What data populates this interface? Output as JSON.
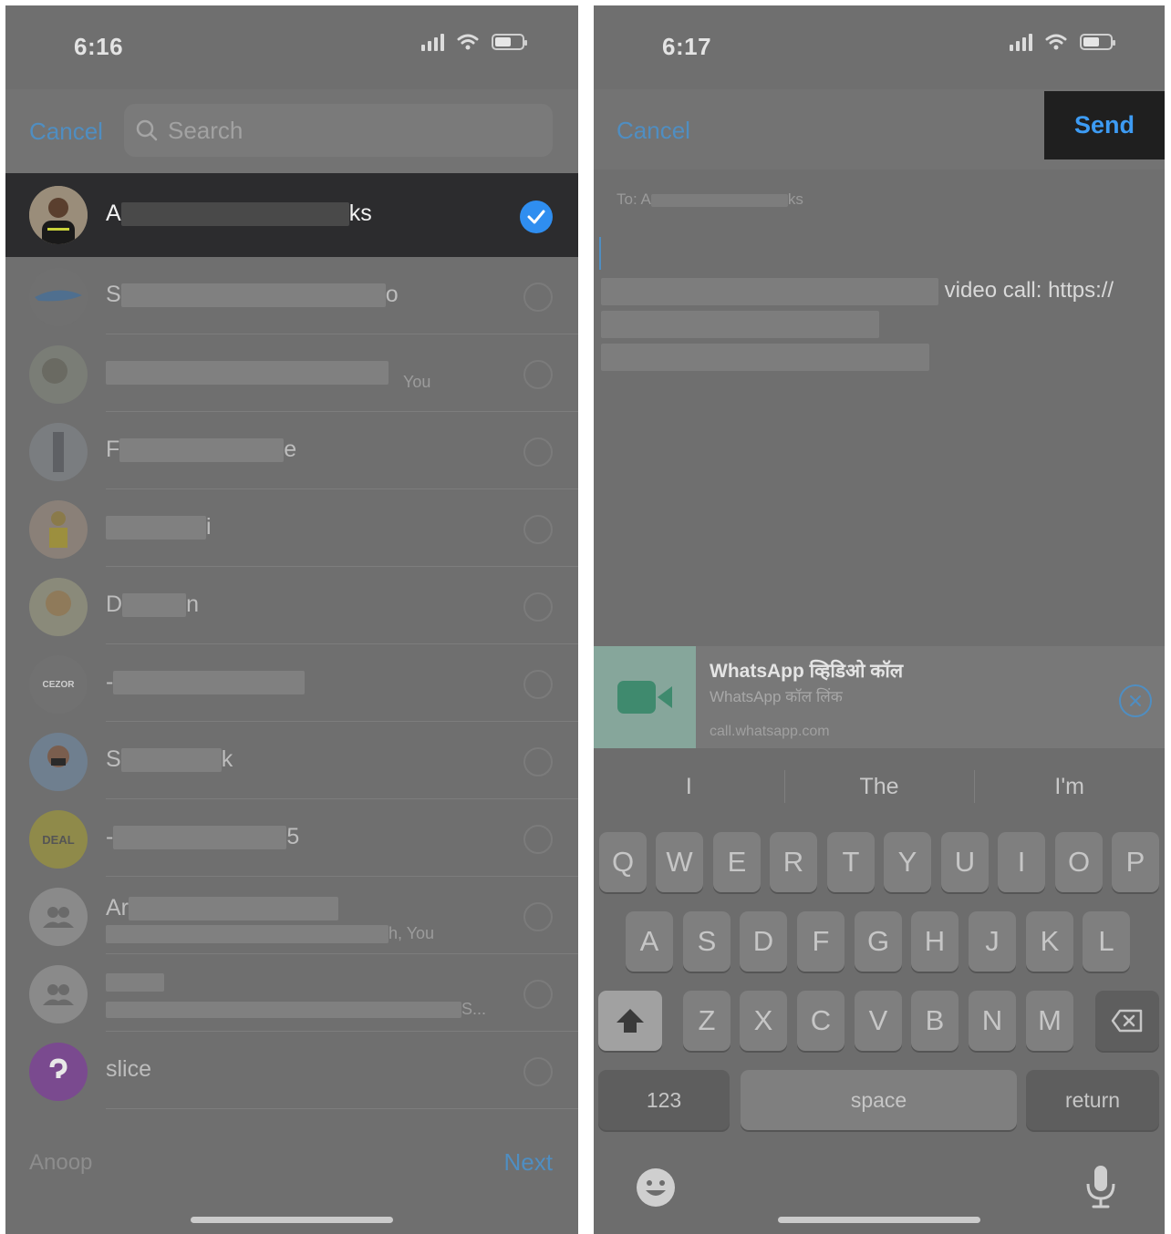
{
  "left": {
    "status_time": "6:16",
    "cancel_label": "Cancel",
    "search_placeholder": "Search",
    "contacts": [
      {
        "name_start": "A",
        "name_end": "ks",
        "sub": "",
        "selected": true
      },
      {
        "name_start": "S",
        "name_end": "o",
        "sub": "",
        "selected": false
      },
      {
        "name_start": "",
        "name_end": "",
        "sub": "You",
        "selected": false
      },
      {
        "name_start": "F",
        "name_end": "e",
        "sub": "",
        "selected": false
      },
      {
        "name_start": "",
        "name_end": "i",
        "sub": "",
        "selected": false
      },
      {
        "name_start": "D",
        "name_end": "n",
        "sub": "",
        "selected": false
      },
      {
        "name_start": "-",
        "name_end": "",
        "sub": "",
        "selected": false
      },
      {
        "name_start": "S",
        "name_end": "k",
        "sub": "",
        "selected": false
      },
      {
        "name_start": "-",
        "name_end": "5",
        "sub": "",
        "selected": false
      },
      {
        "name_start": "Ar",
        "name_end": "",
        "sub": "h, You",
        "selected": false
      },
      {
        "name_start": "",
        "name_end": "",
        "sub": "S...",
        "selected": false
      },
      {
        "name_start": "slice",
        "name_end": "",
        "sub": "",
        "selected": false
      }
    ],
    "avatar_text": {
      "cezor": "CEZOR",
      "deal": "DEAL"
    },
    "selected_name": "Anoop",
    "next_label": "Next"
  },
  "right": {
    "status_time": "6:17",
    "cancel_label": "Cancel",
    "send_label": "Send",
    "to_prefix": "To: A",
    "to_suffix": "ks",
    "body_line1_end": "video call: https://",
    "link_preview": {
      "title": "WhatsApp व्हिडिओ कॉल",
      "subtitle": "WhatsApp कॉल लिंक",
      "url": "call.whatsapp.com"
    },
    "suggestions": [
      "I",
      "The",
      "I'm"
    ],
    "keyboard_rows": [
      [
        "Q",
        "W",
        "E",
        "R",
        "T",
        "Y",
        "U",
        "I",
        "O",
        "P"
      ],
      [
        "A",
        "S",
        "D",
        "F",
        "G",
        "H",
        "J",
        "K",
        "L"
      ],
      [
        "Z",
        "X",
        "C",
        "V",
        "B",
        "N",
        "M"
      ]
    ],
    "key_123": "123",
    "key_space": "space",
    "key_return": "return"
  },
  "colors": {
    "accent": "#2f8ef0",
    "link_blue": "#4f8ec2",
    "whatsapp_green": "#86a69b"
  }
}
